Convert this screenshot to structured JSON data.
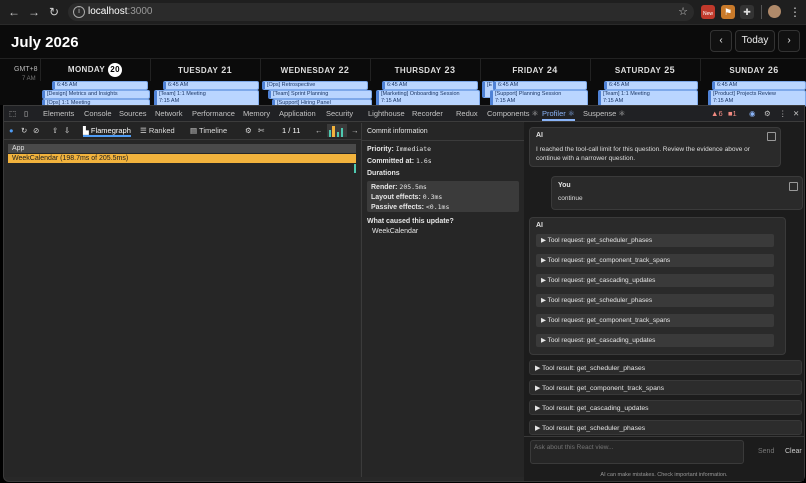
{
  "browser": {
    "url_host": "localhost",
    "url_port": ":3000",
    "back_icon": "arrow-left-icon",
    "new_badge": "New"
  },
  "calendar": {
    "title": "July 2026",
    "today_button": "Today",
    "prev_icon": "chevron-left-icon",
    "next_icon": "chevron-right-icon",
    "timezone": "GMT+8",
    "time_peek": "7 AM",
    "days": [
      {
        "name": "MONDAY",
        "num": "20",
        "today": true
      },
      {
        "name": "TUESDAY",
        "num": "21"
      },
      {
        "name": "WEDNESDAY",
        "num": "22"
      },
      {
        "name": "THURSDAY",
        "num": "23"
      },
      {
        "name": "FRIDAY",
        "num": "24"
      },
      {
        "name": "SATURDAY",
        "num": "25"
      },
      {
        "name": "SUNDAY",
        "num": "26"
      }
    ],
    "events": {
      "mon_time": "6:45 AM",
      "mon_1": "[Design] Metrics and Insights",
      "mon_2": "[Ops] 1:1 Meeting",
      "tue_time": "6:45 AM",
      "tue_1": "[Team] 1:1 Meeting",
      "tue_1_time": "7:15 AM",
      "wed_1": "[Ops] Retrospective",
      "wed_2": "[Team] Sprint Planning",
      "wed_3": "[Support] Hiring Panel",
      "thu_time": "6:45 AM",
      "thu_1": "[Marketing] Onboarding Session",
      "thu_1_time": "7:15 AM",
      "fri_peek": "[E",
      "fri_time": "6:45 AM",
      "fri_1": "[Support] Planning Session",
      "fri_1_time": "7:15 AM",
      "sat_time": "6:45 AM",
      "sat_1": "[Team] 1:1 Meeting",
      "sat_1_time": "7:15 AM",
      "sun_time": "6:45 AM",
      "sun_1": "[Product] Projects Review",
      "sun_1_time": "7:15 AM"
    }
  },
  "devtools": {
    "tabs": [
      "Elements",
      "Console",
      "Sources",
      "Network",
      "Performance",
      "Memory",
      "Application",
      "Security",
      "Lighthouse",
      "Recorder",
      "Redux",
      "Components ⚛",
      "Profiler ⚛",
      "Suspense ⚛"
    ],
    "active_tab": "Profiler ⚛",
    "warnings": "6",
    "errors": "1",
    "profiler": {
      "flamegraph": "Flamegraph",
      "ranked": "Ranked",
      "timeline": "Timeline",
      "commit_index": "1",
      "commit_sep": "/",
      "commit_total": "11",
      "rows": [
        "App",
        "WeekCalendar (198.7ms of 205.5ms)"
      ]
    },
    "commit": {
      "header": "Commit information",
      "priority_label": "Priority:",
      "priority_value": "Immediate",
      "committed_label": "Committed at:",
      "committed_value": "1.6s",
      "durations_label": "Durations",
      "render_label": "Render:",
      "render_value": "205.5ms",
      "layout_label": "Layout effects:",
      "layout_value": "0.3ms",
      "passive_label": "Passive effects:",
      "passive_value": "<0.1ms",
      "cause_label": "What caused this update?",
      "cause_value": "WeekCalendar"
    },
    "chat": {
      "ai_label": "AI",
      "ai_message": "I reached the tool-call limit for this question. Review the evidence above or continue with a narrower question.",
      "user_label": "You",
      "user_message": "continue",
      "ai2_label": "AI",
      "tool_requests": [
        "▶ Tool request: get_scheduler_phases",
        "▶ Tool request: get_component_track_spans",
        "▶ Tool request: get_cascading_updates",
        "▶ Tool request: get_scheduler_phases",
        "▶ Tool request: get_component_track_spans",
        "▶ Tool request: get_cascading_updates"
      ],
      "tool_results": [
        "▶ Tool result: get_scheduler_phases",
        "▶ Tool result: get_component_track_spans",
        "▶ Tool result: get_cascading_updates",
        "▶ Tool result: get_scheduler_phases"
      ],
      "input_placeholder": "Ask about this React view...",
      "send": "Send",
      "clear": "Clear",
      "disclaimer": "AI can make mistakes. Check important information."
    }
  },
  "colors": {
    "accent": "#8ab4f8",
    "flame_bar": "#f2b33d",
    "event_bg": "#b9d5ff"
  }
}
